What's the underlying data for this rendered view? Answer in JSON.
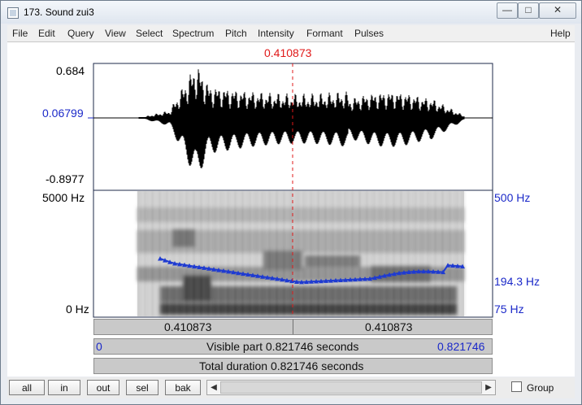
{
  "window": {
    "title": "173. Sound zui3",
    "minimize_glyph": "—",
    "maximize_glyph": "□",
    "close_glyph": "✕"
  },
  "menubar": {
    "items": [
      "File",
      "Edit",
      "Query",
      "View",
      "Select",
      "Spectrum",
      "Pitch",
      "Intensity",
      "Formant",
      "Pulses"
    ],
    "help": "Help"
  },
  "editor": {
    "cursor_time": "0.410873",
    "waveform": {
      "max": "0.684",
      "mid": "0.06799",
      "min": "-0.8977"
    },
    "spectrogram": {
      "top_freq": "5000 Hz",
      "bottom_freq": "0 Hz"
    },
    "pitch": {
      "top": "500 Hz",
      "current": "194.3 Hz",
      "bottom": "75 Hz"
    },
    "segments": {
      "left": "0.410873",
      "right": "0.410873"
    },
    "visible_part": {
      "start": "0",
      "label": "Visible part 0.821746 seconds",
      "end": "0.821746"
    },
    "total_duration": "Total duration 0.821746 seconds"
  },
  "bottombar": {
    "buttons": [
      "all",
      "in",
      "out",
      "sel",
      "bak"
    ],
    "left_arrow": "◀",
    "right_arrow": "▶",
    "group_label": "Group"
  },
  "colors": {
    "label_blue": "#1b29c9",
    "cursor_red": "#e01919",
    "pitch_curve": "#1f3bd1"
  }
}
